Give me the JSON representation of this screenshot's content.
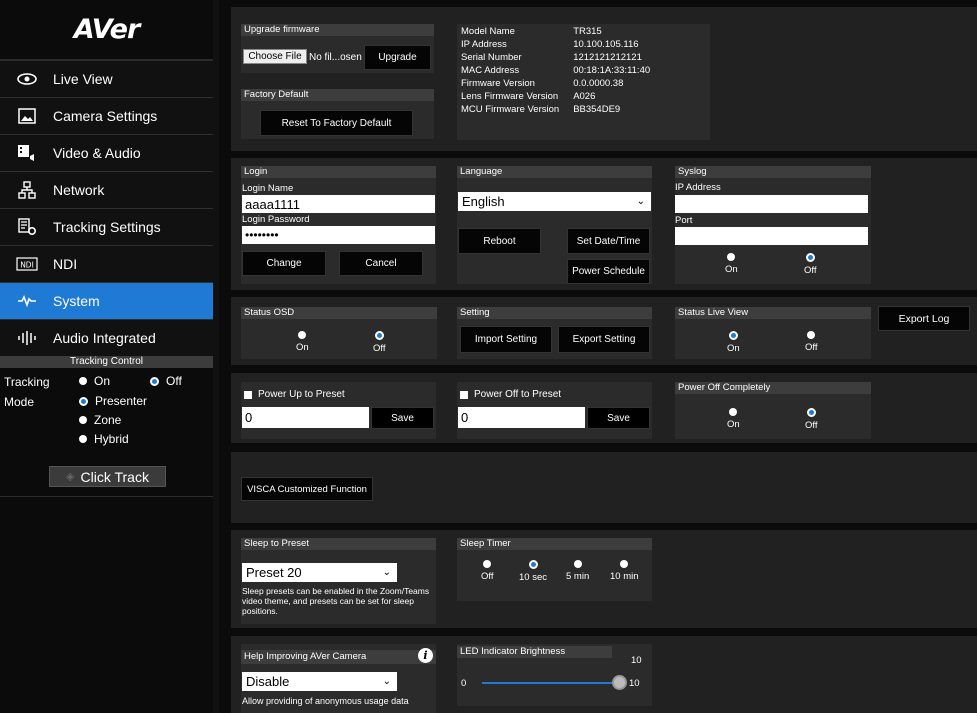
{
  "brand": "AVer",
  "nav": [
    {
      "label": "Live View",
      "icon": "eye-icon"
    },
    {
      "label": "Camera Settings",
      "icon": "image-icon"
    },
    {
      "label": "Video & Audio",
      "icon": "film-icon"
    },
    {
      "label": "Network",
      "icon": "network-icon"
    },
    {
      "label": "Tracking Settings",
      "icon": "doc-gear-icon"
    },
    {
      "label": "NDI",
      "icon": "ndi-icon"
    },
    {
      "label": "System",
      "icon": "pulse-icon"
    },
    {
      "label": "Audio Integrated",
      "icon": "audio-bars-icon"
    }
  ],
  "tracking": {
    "header": "Tracking Control",
    "tracking_label": "Tracking",
    "on": "On",
    "off": "Off",
    "mode_label": "Mode",
    "presenter": "Presenter",
    "zone": "Zone",
    "hybrid": "Hybrid",
    "click_track": "Click Track"
  },
  "upgrade": {
    "title": "Upgrade firmware",
    "choose": "Choose File",
    "nofile": "No fil...osen",
    "upgrade": "Upgrade"
  },
  "factory": {
    "title": "Factory Default",
    "reset": "Reset To Factory Default"
  },
  "info": [
    {
      "k": "Model Name",
      "v": "TR315"
    },
    {
      "k": "IP Address",
      "v": "10.100.105.116"
    },
    {
      "k": "Serial Number",
      "v": "1212121212121"
    },
    {
      "k": "MAC Address",
      "v": "00:18:1A:33:11:40"
    },
    {
      "k": "Firmware Version",
      "v": "0.0.0000.38"
    },
    {
      "k": "Lens Firmware Version",
      "v": "A026"
    },
    {
      "k": "MCU Firmware Version",
      "v": "BB354DE9"
    }
  ],
  "login": {
    "title": "Login",
    "name_label": "Login Name",
    "name_value": "aaaa1111",
    "pw_label": "Login Password",
    "pw_value": "••••••••",
    "change": "Change",
    "cancel": "Cancel"
  },
  "language": {
    "title": "Language",
    "value": "English",
    "reboot": "Reboot",
    "set_date": "Set Date/Time",
    "power_schedule": "Power Schedule"
  },
  "syslog": {
    "title": "Syslog",
    "ip_label": "IP Address",
    "port_label": "Port",
    "on": "On",
    "off": "Off"
  },
  "status_osd": {
    "title": "Status OSD",
    "on": "On",
    "off": "Off"
  },
  "setting": {
    "title": "Setting",
    "import": "Import Setting",
    "export": "Export Setting"
  },
  "status_live": {
    "title": "Status Live View",
    "on": "On",
    "off": "Off"
  },
  "export_log": "Export Log",
  "power_up": {
    "label": "Power Up to Preset",
    "value": "0",
    "save": "Save"
  },
  "power_off": {
    "label": "Power Off to Preset",
    "value": "0",
    "save": "Save"
  },
  "power_off_completely": {
    "title": "Power Off Completely",
    "on": "On",
    "off": "Off"
  },
  "visca": "VISCA Customized Function",
  "sleep_preset": {
    "title": "Sleep to Preset",
    "value": "Preset 20",
    "note": "Sleep presets can be enabled in the Zoom/Teams video theme, and presets can be set for sleep positions."
  },
  "sleep_timer": {
    "title": "Sleep Timer",
    "options": [
      "Off",
      "10 sec",
      "5 min",
      "10 min"
    ]
  },
  "help": {
    "title": "Help Improving AVer Camera",
    "value": "Disable",
    "note": "Allow providing of anonymous usage data"
  },
  "led": {
    "title": "LED Indicator Brightness",
    "value": "10",
    "min": "0",
    "max": "10",
    "level": 10
  }
}
